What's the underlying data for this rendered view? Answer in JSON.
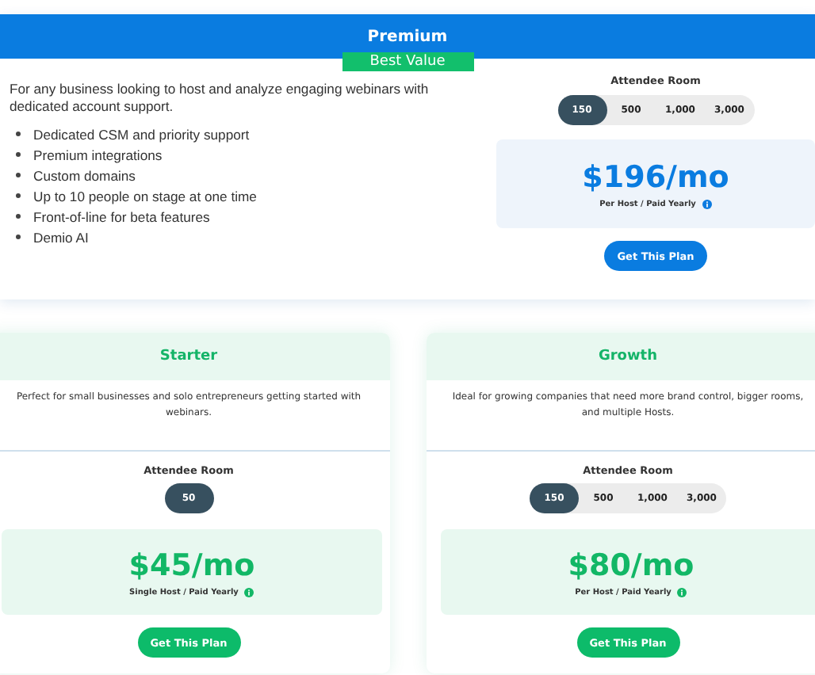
{
  "premium": {
    "name": "Premium",
    "badge": "Best Value",
    "description": "For any business looking to host and analyze engaging webinars with dedicated account support.",
    "features": [
      "Dedicated CSM and priority support",
      "Premium integrations",
      "Custom domains",
      "Up to 10 people on stage at one time",
      "Front-of-line for beta features",
      "Demio AI"
    ],
    "room_label": "Attendee Room",
    "rooms": [
      {
        "label": "150",
        "selected": true
      },
      {
        "label": "500",
        "selected": false
      },
      {
        "label": "1,000",
        "selected": false
      },
      {
        "label": "3,000",
        "selected": false
      }
    ],
    "price": "$196/mo",
    "note": "Per Host / Paid Yearly",
    "button": "Get This Plan"
  },
  "plans": [
    {
      "name": "Starter",
      "description": "Perfect for small businesses and solo entrepreneurs getting started with webinars.",
      "room_label": "Attendee Room",
      "rooms": [
        {
          "label": "50",
          "selected": true
        }
      ],
      "price": "$45/mo",
      "note": "Single Host / Paid Yearly",
      "button": "Get This Plan"
    },
    {
      "name": "Growth",
      "description": "Ideal for growing companies that need more brand control, bigger rooms, and multiple Hosts.",
      "room_label": "Attendee Room",
      "rooms": [
        {
          "label": "150",
          "selected": true
        },
        {
          "label": "500",
          "selected": false
        },
        {
          "label": "1,000",
          "selected": false
        },
        {
          "label": "3,000",
          "selected": false
        }
      ],
      "price": "$80/mo",
      "note": "Per Host / Paid Yearly",
      "button": "Get This Plan"
    }
  ]
}
